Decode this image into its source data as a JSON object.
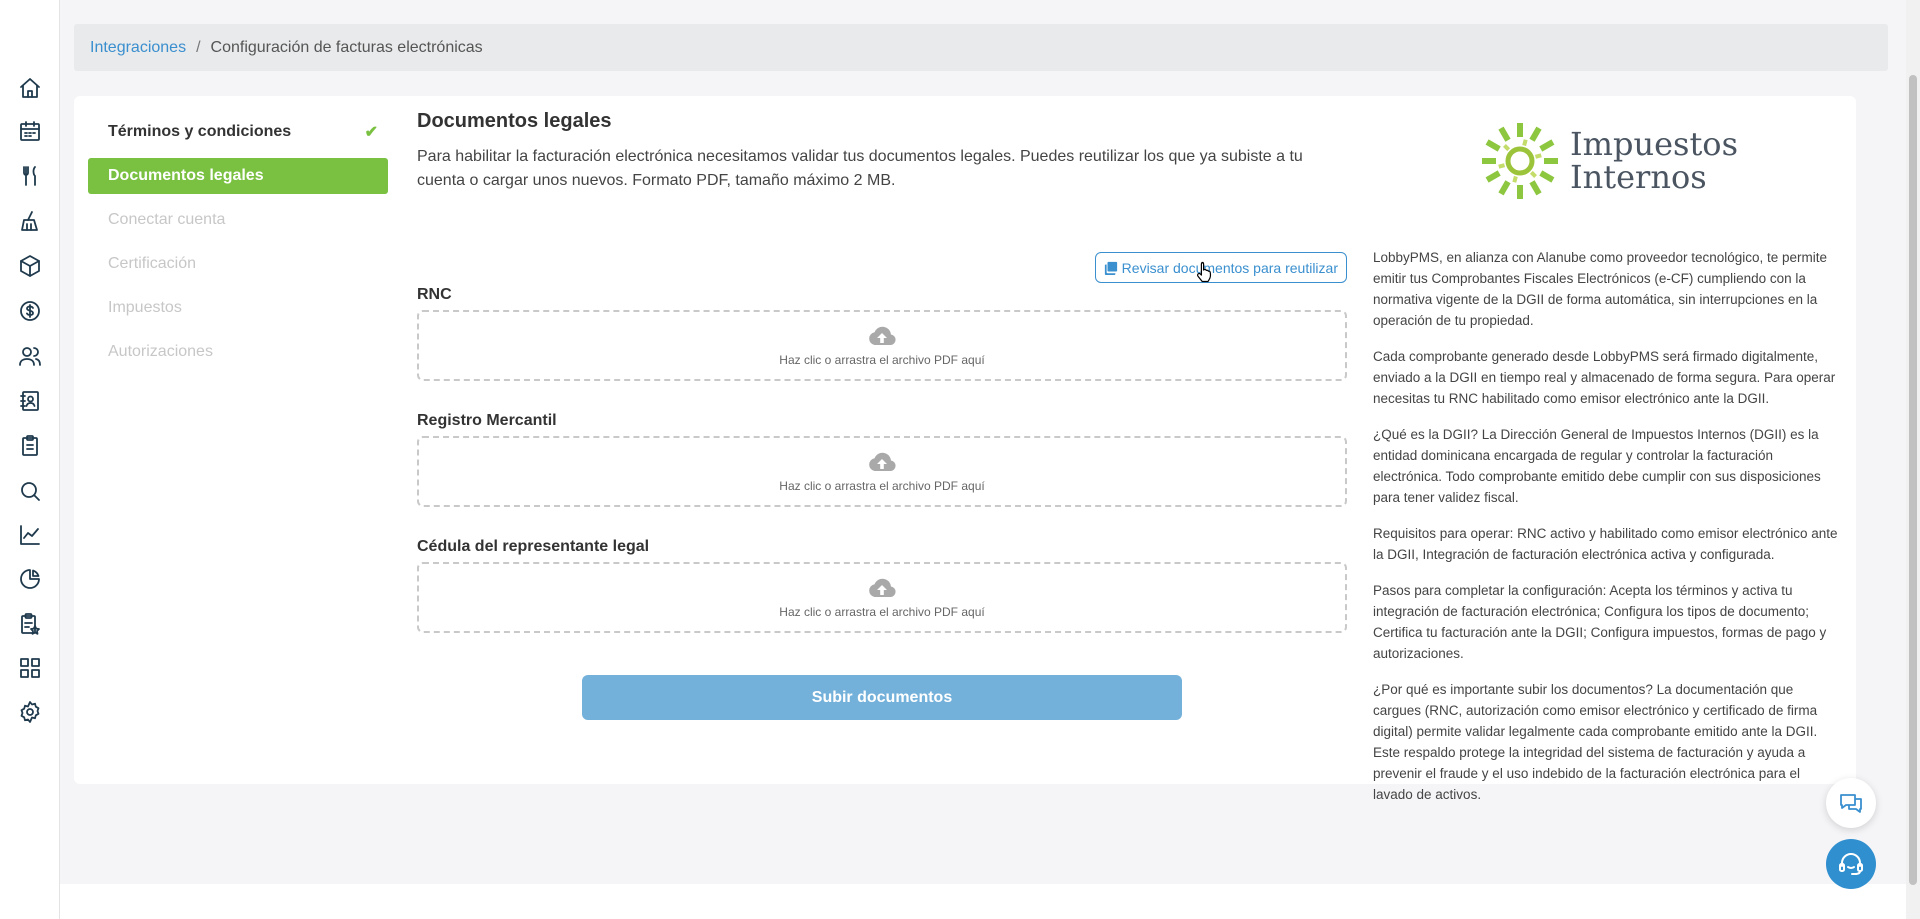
{
  "breadcrumb": {
    "parent": "Integraciones",
    "separator": "/",
    "current": "Configuración de facturas electrónicas"
  },
  "nav_icons": [
    "home-icon",
    "calendar-icon",
    "restaurant-icon",
    "cleaning-icon",
    "package-icon",
    "dollar-icon",
    "users-icon",
    "contacts-icon",
    "clipboard-icon",
    "search-icon",
    "chart-icon",
    "pie-chart-icon",
    "tasks-icon",
    "apps-icon",
    "settings-icon"
  ],
  "steps": [
    {
      "label": "Términos y condiciones",
      "state": "done"
    },
    {
      "label": "Documentos legales",
      "state": "active"
    },
    {
      "label": "Conectar cuenta",
      "state": "disabled"
    },
    {
      "label": "Certificación",
      "state": "disabled"
    },
    {
      "label": "Impuestos",
      "state": "disabled"
    },
    {
      "label": "Autorizaciones",
      "state": "disabled"
    }
  ],
  "form": {
    "title": "Documentos legales",
    "intro": "Para habilitar la facturación electrónica necesitamos validar tus documentos legales. Puedes reutilizar los que ya subiste a tu cuenta o cargar unos nuevos. Formato PDF, tamaño máximo 2 MB.",
    "reuse_button": "Revisar documentos para reutilizar",
    "fields": [
      {
        "label": "RNC",
        "dropzone_text": "Haz clic o arrastra el archivo PDF aquí"
      },
      {
        "label": "Registro Mercantil",
        "dropzone_text": "Haz clic o arrastra el archivo PDF aquí"
      },
      {
        "label": "Cédula del representante legal",
        "dropzone_text": "Haz clic o arrastra el archivo PDF aquí"
      }
    ],
    "submit_button": "Subir documentos"
  },
  "info": {
    "logo_line1": "Impuestos",
    "logo_line2": "Internos",
    "paragraphs": [
      "LobbyPMS, en alianza con Alanube como proveedor tecnológico, te permite emitir tus Comprobantes Fiscales Electrónicos (e-CF) cumpliendo con la normativa vigente de la DGII de forma automática, sin interrupciones en la operación de tu propiedad.",
      "Cada comprobante generado desde LobbyPMS será firmado digitalmente, enviado a la DGII en tiempo real y almacenado de forma segura. Para operar necesitas tu RNC habilitado como emisor electrónico ante la DGII.",
      "¿Qué es la DGII? La Dirección General de Impuestos Internos (DGII) es la entidad dominicana encargada de regular y controlar la facturación electrónica. Todo comprobante emitido debe cumplir con sus disposiciones para tener validez fiscal.",
      "Requisitos para operar: RNC activo y habilitado como emisor electrónico ante la DGII, Integración de facturación electrónica activa y configurada.",
      "Pasos para completar la configuración: Acepta los términos y activa tu integración de facturación electrónica; Configura los tipos de documento; Certifica tu facturación ante la DGII; Configura impuestos, formas de pago y autorizaciones.",
      "¿Por qué es importante subir los documentos? La documentación que cargues (RNC, autorización como emisor electrónico y certificado de firma digital) permite validar legalmente cada comprobante emitido ante la DGII. Este respaldo protege la integridad del sistema de facturación y ayuda a prevenir el fraude y el uso indebido de la facturación electrónica para el lavado de activos."
    ]
  },
  "colors": {
    "accent_green": "#7ac142",
    "link_blue": "#3a8fcf",
    "submit_blue": "#74b1da",
    "nav_icon": "#1f3a4d"
  }
}
